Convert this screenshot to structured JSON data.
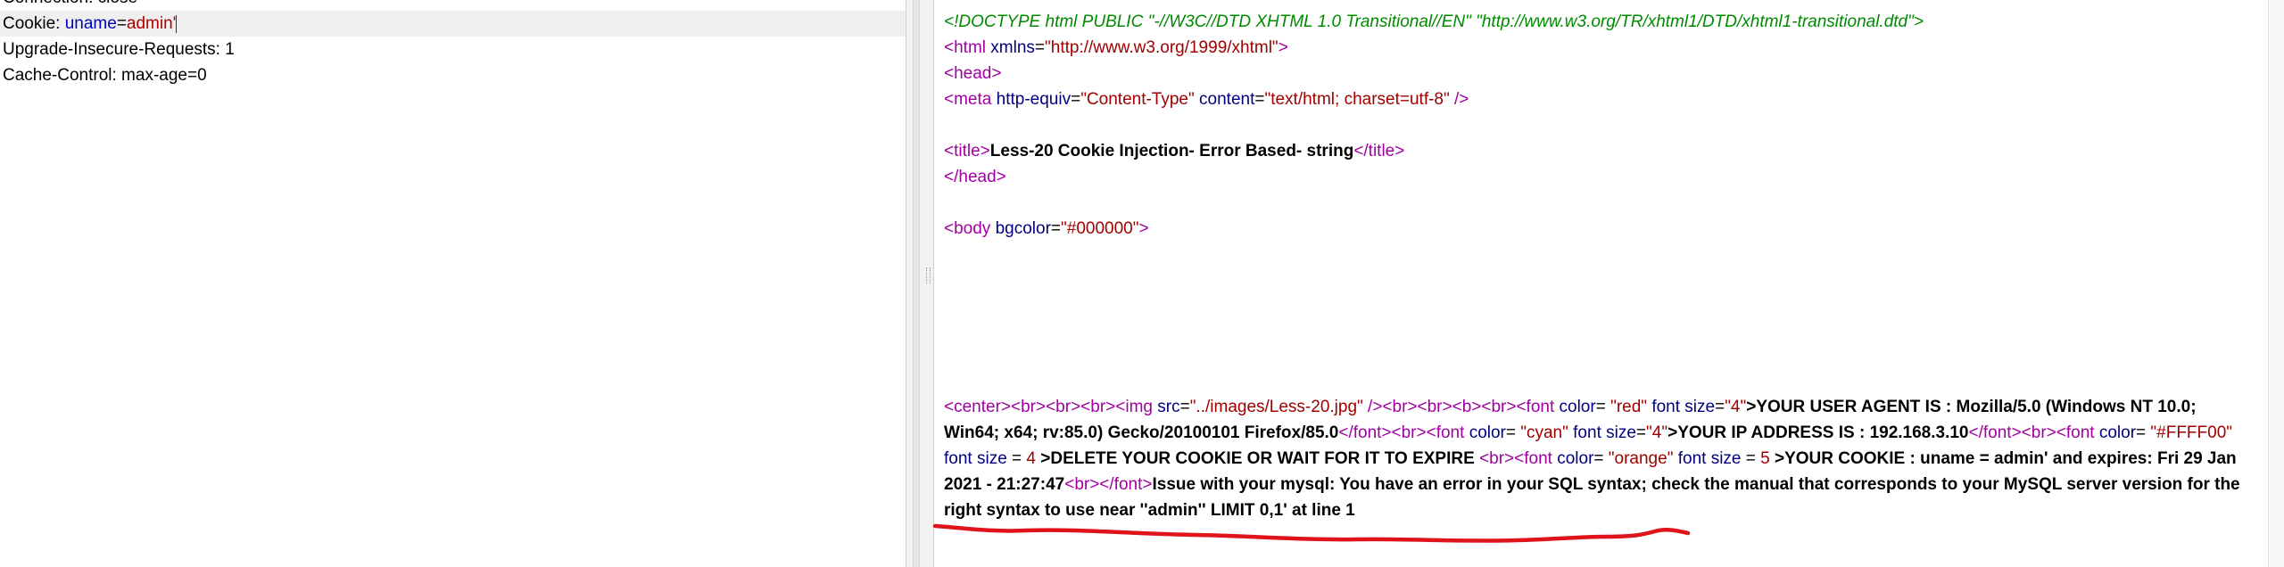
{
  "request": {
    "cutoff_line": "Connection: close",
    "cookie_key": "Cookie:",
    "cookie_name": "uname",
    "cookie_eq": "=",
    "cookie_value": "admin'",
    "upgrade_line": "Upgrade-Insecure-Requests: 1",
    "cache_line": "Cache-Control: max-age=0"
  },
  "response": {
    "doctype": "<!DOCTYPE html PUBLIC \"-//W3C//DTD XHTML 1.0 Transitional//EN\" \"http://www.w3.org/TR/xhtml1/DTD/xhtml1-transitional.dtd\">",
    "html_open_tag": "<html",
    "html_attr": "xmlns",
    "html_attr_val": "\"http://www.w3.org/1999/xhtml\"",
    "head_open": "<head>",
    "meta_tag": "<meta",
    "meta_attr1": "http-equiv",
    "meta_val1": "\"Content-Type\"",
    "meta_attr2": "content",
    "meta_val2": "\"text/html; charset=utf-8\"",
    "meta_close": "/>",
    "title_open": "<title>",
    "title_text": "Less-20 Cookie Injection- Error Based- string",
    "title_close": "</title>",
    "head_close": "</head>",
    "body_tag": "<body",
    "body_attr": "bgcolor",
    "body_val": "\"#000000\"",
    "body_end": ">",
    "center_seg1": "<center><br><br><br><img ",
    "center_src_attr": "src",
    "center_src_val": "\"../images/Less-20.jpg\"",
    "center_seg2": " /><br><br><b><br><font ",
    "f1_color_attr": "color",
    "f1_color_val": "\"red\"",
    "f1_size_attr": "font size",
    "f1_size_val": "\"4\"",
    "useragent_text": ">YOUR USER AGENT IS : Mozilla/5.0 (Windows NT 10.0; Win64; x64; rv:85.0) Gecko/20100101 Firefox/85.0",
    "f1_close": "</font><br><font ",
    "f2_color_attr": "color",
    "f2_color_val": "\"cyan\"",
    "f2_size_attr": "font size",
    "f2_size_val": "\"4\"",
    "ip_text": ">YOUR IP ADDRESS IS : 192.168.3.10",
    "f2_close": "</font><br><font ",
    "f3_color_attr": "color",
    "f3_color_val": "\"#FFFF00\"",
    "f3_size_attr": "font size",
    "f3_size_val": "4",
    "delete_text": ">DELETE YOUR COOKIE OR WAIT FOR IT TO EXPIRE ",
    "br_font": "<br><font ",
    "f4_color_attr": "color",
    "f4_color_val": "\"orange\"",
    "f4_size_attr": "font size",
    "f4_size_val": "5",
    "cookie_text": ">YOUR COOKIE : uname = admin' and expires: Fri 29 Jan 2021 - 21:27:47",
    "br_close": "<br></font>",
    "error_text": "Issue with your mysql: You have an error in your SQL syntax; check the manual that corresponds to your MySQL server version for the right syntax to use near ''admin'' LIMIT 0,1' at line 1"
  },
  "colors": {
    "tag": "#a000a0",
    "attribute": "#000080",
    "value": "#a00000",
    "doctype": "#008a00",
    "annotation": "#e0141c"
  }
}
